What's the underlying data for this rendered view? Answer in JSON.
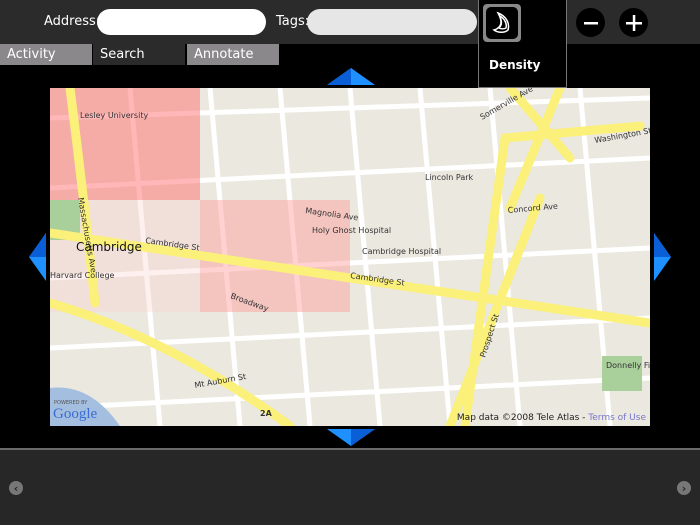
{
  "toolbar": {
    "address_label": "Address:",
    "address_value": "",
    "tags_label": "Tags:",
    "tags_value": ""
  },
  "menu": {
    "density_label": "Density"
  },
  "tabs": [
    {
      "label": "Activity"
    },
    {
      "label": "Search"
    },
    {
      "label": "Annotate"
    }
  ],
  "icons": {
    "density": "density-icon",
    "favorite": "star-icon",
    "zoom_out": "minus-icon",
    "zoom_in": "plus-icon"
  },
  "map": {
    "labels": {
      "cambridge": "Cambridge",
      "cambridge_st": "Cambridge St",
      "cambridge_st2": "Cambridge St",
      "lesley": "Lesley University",
      "holy_ghost": "Holy Ghost Hospital",
      "cambridge_hospital": "Cambridge Hospital",
      "harvard": "Harvard College",
      "somerville": "Somerville Ave",
      "washington": "Washington St",
      "lincoln": "Lincoln Park",
      "magnolia": "Magnolia Ave",
      "broadway": "Broadway",
      "mt_auburn": "Mt Auburn St",
      "prospect": "Prospect St",
      "donnelly": "Donnelly Field",
      "mass_ave": "Massachusetts Ave",
      "concord": "Concord Ave",
      "route": "2A"
    },
    "attribution": "Map data ©2008 Tele Atlas - ",
    "terms": "Terms of Use",
    "logo_powered": "POWERED BY",
    "logo": "Google"
  },
  "colors": {
    "accent": "#1e90ff",
    "road": "#fbf07a",
    "overlay": "#ff6f6f"
  }
}
